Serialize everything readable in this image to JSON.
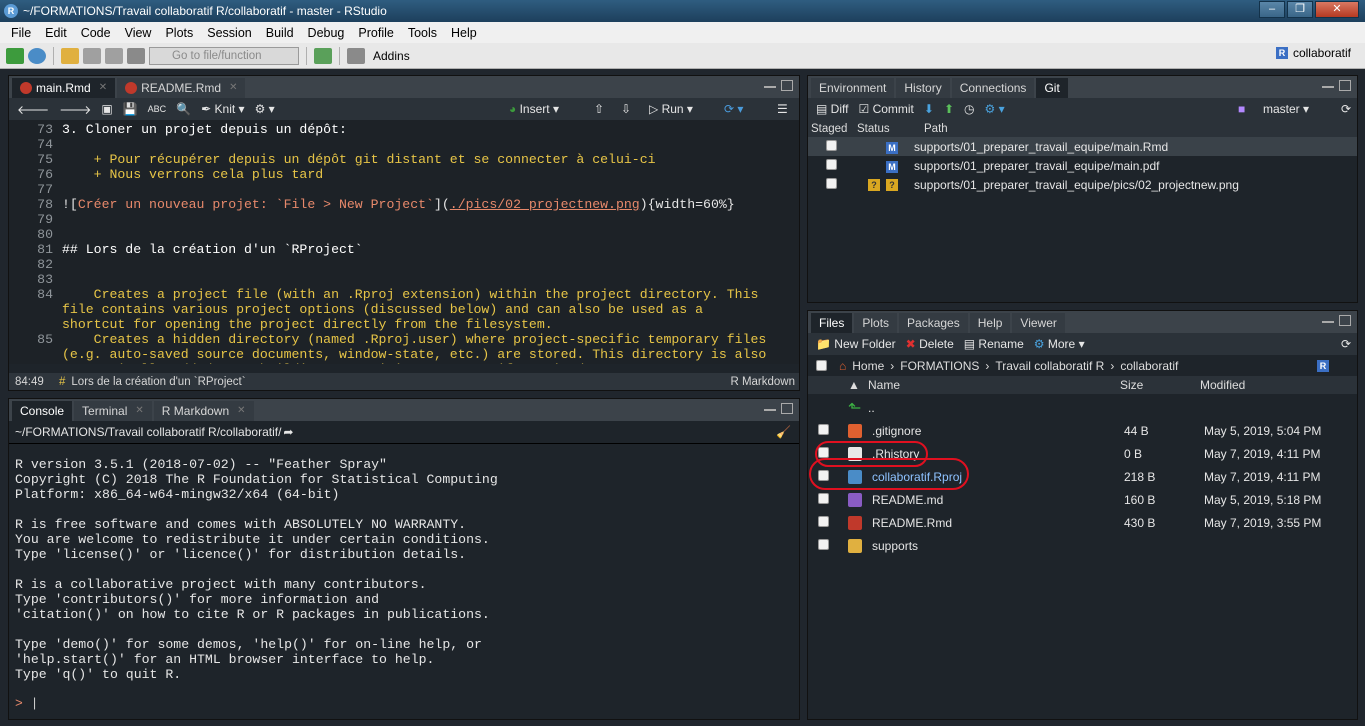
{
  "window": {
    "title": "~/FORMATIONS/Travail collaboratif R/collaboratif - master - RStudio",
    "icon": "R"
  },
  "menu": [
    "File",
    "Edit",
    "Code",
    "View",
    "Plots",
    "Session",
    "Build",
    "Debug",
    "Profile",
    "Tools",
    "Help"
  ],
  "toolbar": {
    "goto_placeholder": "Go to file/function",
    "addins": "Addins",
    "project": "collaboratif"
  },
  "source": {
    "tabs": [
      {
        "label": "main.Rmd",
        "active": true
      },
      {
        "label": "README.Rmd",
        "active": false
      }
    ],
    "tools": {
      "knit": "Knit",
      "insert": "Insert",
      "run": "Run"
    },
    "lines": [
      {
        "n": "73",
        "text": "3. Cloner un projet depuis un dépôt:"
      },
      {
        "n": "74",
        "text": ""
      },
      {
        "n": "75",
        "text": "    + Pour récupérer depuis un dépôt git distant et se connecter à celui-ci"
      },
      {
        "n": "76",
        "text": "    + Nous verrons cela plus tard"
      },
      {
        "n": "77",
        "text": ""
      },
      {
        "n": "78",
        "text_a": "![",
        "text_b": "Créer un nouveau projet: `File > New Project`",
        "text_c": "](",
        "text_d": "./pics/02_projectnew.png",
        "text_e": "){width=60%}"
      },
      {
        "n": "79",
        "text": ""
      },
      {
        "n": "80",
        "text": ""
      },
      {
        "n": "81",
        "text": "## Lors de la création d'un `RProject`"
      },
      {
        "n": "82",
        "text": ""
      },
      {
        "n": "83",
        "text": ""
      },
      {
        "n": "84",
        "text": "    Creates a project file (with an .Rproj extension) within the project directory. This\nfile contains various project options (discussed below) and can also be used as a\nshortcut for opening the project directly from the filesystem."
      },
      {
        "n": "85",
        "text": "    Creates a hidden directory (named .Rproj.user) where project-specific temporary files\n(e.g. auto-saved source documents, window-state, etc.) are stored. This directory is also\nautomatically added to .Rbuildignore, .gitignore, etc. if required."
      }
    ],
    "status": {
      "pos": "84:49",
      "section": "Lors de la création d'un `RProject`",
      "mode": "R Markdown"
    }
  },
  "console": {
    "tabs": [
      {
        "label": "Console",
        "active": true
      },
      {
        "label": "Terminal",
        "active": false
      },
      {
        "label": "R Markdown",
        "active": false
      }
    ],
    "path": "~/FORMATIONS/Travail collaboratif R/collaboratif/",
    "output": "R version 3.5.1 (2018-07-02) -- \"Feather Spray\"\nCopyright (C) 2018 The R Foundation for Statistical Computing\nPlatform: x86_64-w64-mingw32/x64 (64-bit)\n\nR is free software and comes with ABSOLUTELY NO WARRANTY.\nYou are welcome to redistribute it under certain conditions.\nType 'license()' or 'licence()' for distribution details.\n\nR is a collaborative project with many contributors.\nType 'contributors()' for more information and\n'citation()' on how to cite R or R packages in publications.\n\nType 'demo()' for some demos, 'help()' for on-line help, or\n'help.start()' for an HTML browser interface to help.\nType 'q()' to quit R.",
    "prompt": ">"
  },
  "env": {
    "tabs": [
      {
        "label": "Environment",
        "active": false
      },
      {
        "label": "History",
        "active": false
      },
      {
        "label": "Connections",
        "active": false
      },
      {
        "label": "Git",
        "active": true
      }
    ],
    "tools": {
      "diff": "Diff",
      "commit": "Commit",
      "branch": "master"
    },
    "headers": {
      "staged": "Staged",
      "status": "Status",
      "path": "Path"
    },
    "rows": [
      {
        "status": "M",
        "status2": "",
        "path": "supports/01_preparer_travail_equipe/main.Rmd",
        "selected": true
      },
      {
        "status": "M",
        "status2": "",
        "path": "supports/01_preparer_travail_equipe/main.pdf",
        "selected": false
      },
      {
        "status": "?",
        "status2": "?",
        "path": "supports/01_preparer_travail_equipe/pics/02_projectnew.png",
        "selected": false
      }
    ]
  },
  "files": {
    "tabs": [
      {
        "label": "Files",
        "active": true
      },
      {
        "label": "Plots",
        "active": false
      },
      {
        "label": "Packages",
        "active": false
      },
      {
        "label": "Help",
        "active": false
      },
      {
        "label": "Viewer",
        "active": false
      }
    ],
    "tools": {
      "new_folder": "New Folder",
      "delete": "Delete",
      "rename": "Rename",
      "more": "More"
    },
    "breadcrumb": [
      "Home",
      "FORMATIONS",
      "Travail collaboratif R",
      "collaboratif"
    ],
    "headers": {
      "name": "Name",
      "size": "Size",
      "modified": "Modified"
    },
    "up": "..",
    "rows": [
      {
        "name": ".gitignore",
        "size": "44 B",
        "modified": "May 5, 2019, 5:04 PM",
        "icon": "gitignore-file-icon"
      },
      {
        "name": ".Rhistory",
        "size": "0 B",
        "modified": "May 7, 2019, 4:11 PM",
        "icon": "rhistory-file-icon"
      },
      {
        "name": "collaboratif.Rproj",
        "size": "218 B",
        "modified": "May 7, 2019, 4:11 PM",
        "icon": "rproj-file-icon"
      },
      {
        "name": "README.md",
        "size": "160 B",
        "modified": "May 5, 2019, 5:18 PM",
        "icon": "md-file-icon"
      },
      {
        "name": "README.Rmd",
        "size": "430 B",
        "modified": "May 7, 2019, 3:55 PM",
        "icon": "rmd-file-icon"
      },
      {
        "name": "supports",
        "size": "",
        "modified": "",
        "icon": "folder-icon"
      }
    ]
  },
  "colors": {
    "accent": "#e01020",
    "bg": "#1e242a"
  }
}
